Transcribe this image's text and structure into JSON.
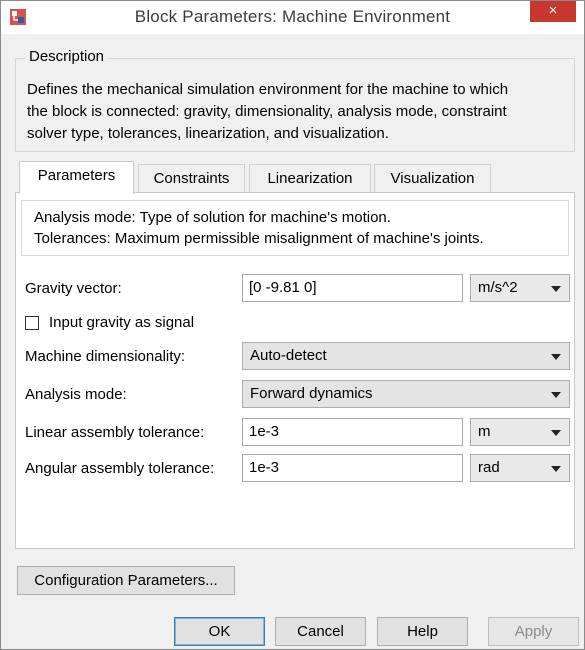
{
  "window": {
    "title": "Block Parameters: Machine Environment",
    "close_label": "×"
  },
  "description": {
    "legend": "Description",
    "lines": [
      "Defines the mechanical simulation environment for the machine to which",
      "the block is connected: gravity, dimensionality, analysis mode, constraint",
      "solver type, tolerances, linearization, and visualization."
    ]
  },
  "tabs": [
    {
      "label": "Parameters",
      "active": true
    },
    {
      "label": "Constraints",
      "active": false
    },
    {
      "label": "Linearization",
      "active": false
    },
    {
      "label": "Visualization",
      "active": false
    }
  ],
  "info": {
    "line1": "Analysis mode: Type of solution for machine's motion.",
    "line2": "Tolerances: Maximum permissible misalignment of machine's joints."
  },
  "params": {
    "gravity": {
      "label": "Gravity vector:",
      "value": "[0 -9.81 0]",
      "unit": "m/s^2"
    },
    "input_gravity": {
      "label": "Input gravity as signal",
      "checked": false
    },
    "dimensionality": {
      "label": "Machine dimensionality:",
      "value": "Auto-detect"
    },
    "analysis_mode": {
      "label": "Analysis mode:",
      "value": "Forward dynamics"
    },
    "linear_tol": {
      "label": "Linear assembly tolerance:",
      "value": "1e-3",
      "unit": "m"
    },
    "angular_tol": {
      "label": "Angular assembly tolerance:",
      "value": "1e-3",
      "unit": "rad"
    }
  },
  "buttons": {
    "config": "Configuration Parameters...",
    "ok": "OK",
    "cancel": "Cancel",
    "help": "Help",
    "apply": "Apply"
  }
}
